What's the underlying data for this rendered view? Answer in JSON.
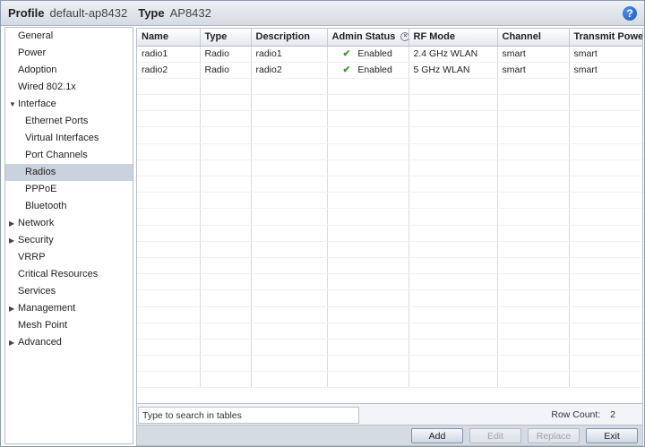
{
  "header": {
    "profile_label": "Profile",
    "profile_value": "default-ap8432",
    "type_label": "Type",
    "type_value": "AP8432",
    "help_glyph": "?"
  },
  "sidebar": {
    "items": [
      {
        "label": "General",
        "level": 0
      },
      {
        "label": "Power",
        "level": 0
      },
      {
        "label": "Adoption",
        "level": 0
      },
      {
        "label": "Wired 802.1x",
        "level": 0
      },
      {
        "label": "Interface",
        "level": 0,
        "expander": "expanded"
      },
      {
        "label": "Ethernet Ports",
        "level": 1
      },
      {
        "label": "Virtual Interfaces",
        "level": 1
      },
      {
        "label": "Port Channels",
        "level": 1
      },
      {
        "label": "Radios",
        "level": 1,
        "selected": true
      },
      {
        "label": "PPPoE",
        "level": 1
      },
      {
        "label": "Bluetooth",
        "level": 1
      },
      {
        "label": "Network",
        "level": 0,
        "expander": "collapsed"
      },
      {
        "label": "Security",
        "level": 0,
        "expander": "collapsed"
      },
      {
        "label": "VRRP",
        "level": 0
      },
      {
        "label": "Critical Resources",
        "level": 0
      },
      {
        "label": "Services",
        "level": 0
      },
      {
        "label": "Management",
        "level": 0,
        "expander": "collapsed"
      },
      {
        "label": "Mesh Point",
        "level": 0
      },
      {
        "label": "Advanced",
        "level": 0,
        "expander": "collapsed"
      }
    ]
  },
  "table": {
    "columns": [
      "Name",
      "Type",
      "Description",
      "Admin Status",
      "RF Mode",
      "Channel",
      "Transmit Power"
    ],
    "rows": [
      [
        "radio1",
        "Radio",
        "radio1",
        "Enabled",
        "2.4 GHz WLAN",
        "smart",
        "smart"
      ],
      [
        "radio2",
        "Radio",
        "radio2",
        "Enabled",
        "5 GHz WLAN",
        "smart",
        "smart"
      ]
    ]
  },
  "search": {
    "placeholder": "Type to search in tables"
  },
  "rowcount": {
    "label": "Row Count:",
    "value": "2"
  },
  "buttons": {
    "add": "Add",
    "edit": "Edit",
    "replace": "Replace",
    "exit": "Exit"
  },
  "icons": {
    "enabled": "check-icon",
    "filter": "filter-clear-icon",
    "expanded": "triangle-down-icon",
    "collapsed": "triangle-right-icon"
  },
  "colors": {
    "selected_nav": "#c9d2de",
    "check": "#3a9a2a",
    "help": "#1b57c0"
  }
}
